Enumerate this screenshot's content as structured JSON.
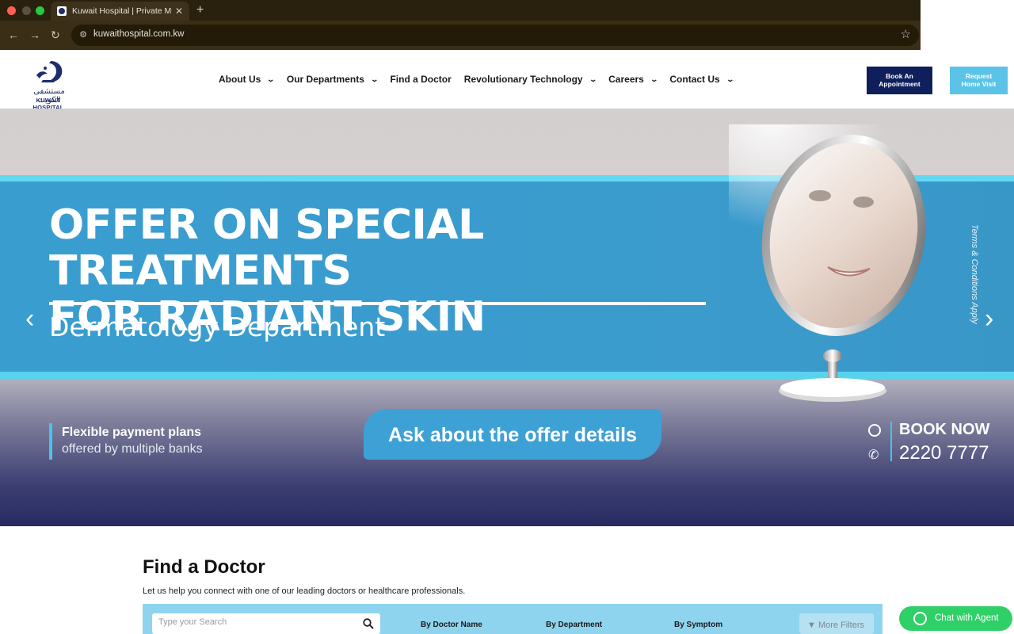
{
  "browser": {
    "tab_title": "Kuwait Hospital | Private Multi",
    "tab_close": "✕",
    "new_tab": "+",
    "url": "kuwaithospital.com.kw",
    "back": "←",
    "forward": "→",
    "reload": "↻",
    "star": "☆"
  },
  "header": {
    "logo_ar": "مستشفى الكويت",
    "logo_en": "KUWAIT HOSPITAL",
    "nav": [
      {
        "label": "About Us",
        "has_dropdown": true
      },
      {
        "label": "Our Departments",
        "has_dropdown": true
      },
      {
        "label": "Find a Doctor",
        "has_dropdown": false
      },
      {
        "label": "Revolutionary Technology",
        "has_dropdown": true
      },
      {
        "label": "Careers",
        "has_dropdown": true
      },
      {
        "label": "Contact Us",
        "has_dropdown": true
      }
    ],
    "book_line1": "Book An",
    "book_line2": "Appointment",
    "visit_line1": "Request",
    "visit_line2": "Home Visit"
  },
  "hero": {
    "headline_line1": "OFFER ON SPECIAL TREATMENTS",
    "headline_line2": "FOR RADIANT SKIN",
    "subtitle": "Dermatology Department",
    "terms": "Terms & Conditions Apply",
    "payment_line1": "Flexible payment plans",
    "payment_line2": "offered by multiple banks",
    "cta": "Ask about the offer details",
    "book_now": "BOOK NOW",
    "phone": "2220 7777",
    "prev": "‹",
    "next": "›"
  },
  "finder": {
    "title": "Find a Doctor",
    "description": "Let us help you connect with one of our leading doctors or healthcare professionals.",
    "search_placeholder": "Type your Search",
    "tabs": [
      "By Doctor Name",
      "By Department",
      "By Symptom"
    ],
    "more_filters": "More Filters"
  },
  "chat": {
    "label": "Chat with Agent"
  },
  "colors": {
    "brand_navy": "#0e1f5c",
    "brand_sky": "#5bc3e8",
    "hero_blue": "#3a9dd0",
    "chat_green": "#2fd067"
  }
}
